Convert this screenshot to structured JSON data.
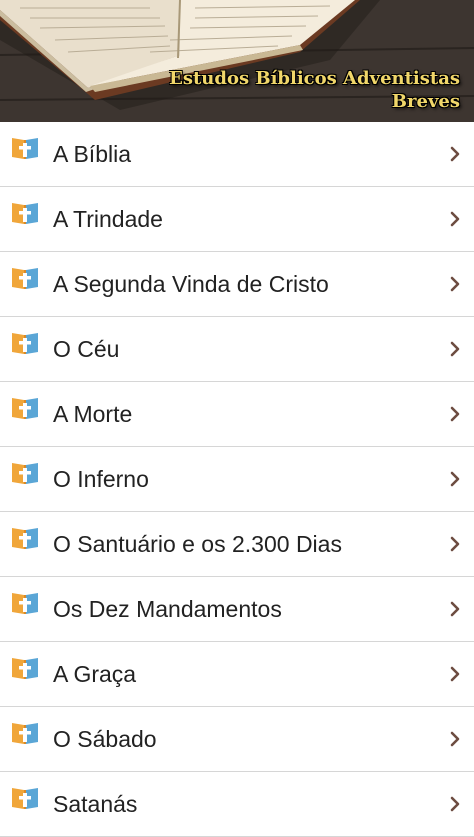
{
  "header": {
    "title_line1": "Estudos Bíblicos Adventistas",
    "title_line2": "Breves",
    "title_color": "#f1d76a"
  },
  "icon_colors": {
    "book_left": "#f0a63a",
    "book_right": "#5aa6d6",
    "cross": "#ffffff"
  },
  "chevron_color": "#6d4c41",
  "list": {
    "items": [
      {
        "label": "A Bíblia"
      },
      {
        "label": "A Trindade"
      },
      {
        "label": "A Segunda Vinda de Cristo"
      },
      {
        "label": "O Céu"
      },
      {
        "label": "A Morte"
      },
      {
        "label": "O Inferno"
      },
      {
        "label": "O Santuário e os 2.300 Dias"
      },
      {
        "label": "Os Dez Mandamentos"
      },
      {
        "label": "A Graça"
      },
      {
        "label": "O Sábado"
      },
      {
        "label": "Satanás"
      }
    ]
  }
}
